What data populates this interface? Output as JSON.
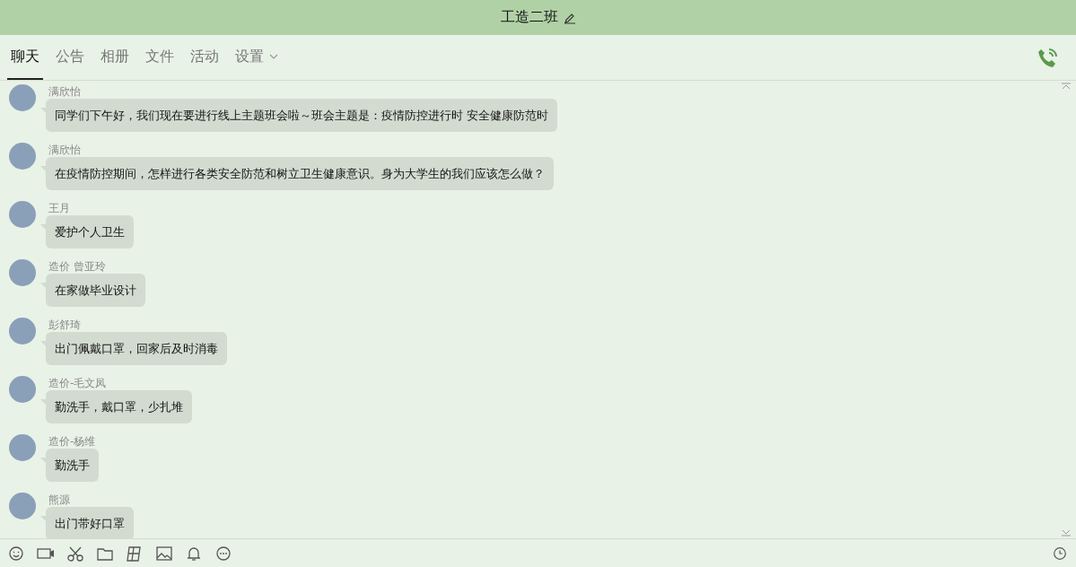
{
  "window": {
    "title": "工造二班"
  },
  "tabs": [
    {
      "label": "聊天",
      "selected": true,
      "dropdown": false
    },
    {
      "label": "公告",
      "selected": false,
      "dropdown": false
    },
    {
      "label": "相册",
      "selected": false,
      "dropdown": false
    },
    {
      "label": "文件",
      "selected": false,
      "dropdown": false
    },
    {
      "label": "活动",
      "selected": false,
      "dropdown": false
    },
    {
      "label": "设置",
      "selected": false,
      "dropdown": true
    }
  ],
  "messages": [
    {
      "sender": "满欣怡",
      "text": "同学们下午好，我们现在要进行线上主题班会啦～班会主题是：疫情防控进行时  安全健康防范时"
    },
    {
      "sender": "满欣怡",
      "text": "在疫情防控期间，怎样进行各类安全防范和树立卫生健康意识。身为大学生的我们应该怎么做？"
    },
    {
      "sender": "王月",
      "text": "爱护个人卫生"
    },
    {
      "sender": "造价 曾亚玲",
      "text": "在家做毕业设计"
    },
    {
      "sender": "彭舒琦",
      "text": "出门佩戴口罩，回家后及时消毒"
    },
    {
      "sender": "造价-毛文凤",
      "text": "勤洗手，戴口罩，少扎堆"
    },
    {
      "sender": "造价-杨维",
      "text": "勤洗手"
    },
    {
      "sender": "熊源",
      "text": "出门带好口罩"
    }
  ]
}
